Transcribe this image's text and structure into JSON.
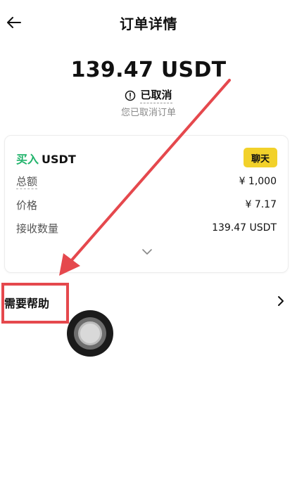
{
  "header": {
    "title": "订单详情",
    "back_icon": "arrow-left-icon"
  },
  "order": {
    "amount": "139.47 USDT",
    "status": "已取消",
    "status_icon": "info-circle-icon",
    "status_subtitle": "您已取消订单"
  },
  "card": {
    "side": "买入",
    "asset": "USDT",
    "chat_label": "聊天",
    "rows": [
      {
        "label": "总额",
        "value": "¥ 1,000"
      },
      {
        "label": "价格",
        "value": "¥ 7.17"
      },
      {
        "label": "接收数量",
        "value": "139.47 USDT"
      }
    ],
    "expand_icon": "chevron-down-icon"
  },
  "help": {
    "label": "需要帮助",
    "icon": "chevron-right-icon"
  },
  "colors": {
    "buy_green": "#21b36b",
    "chat_yellow": "#f2d12a",
    "annotation_red": "#e5484d"
  }
}
